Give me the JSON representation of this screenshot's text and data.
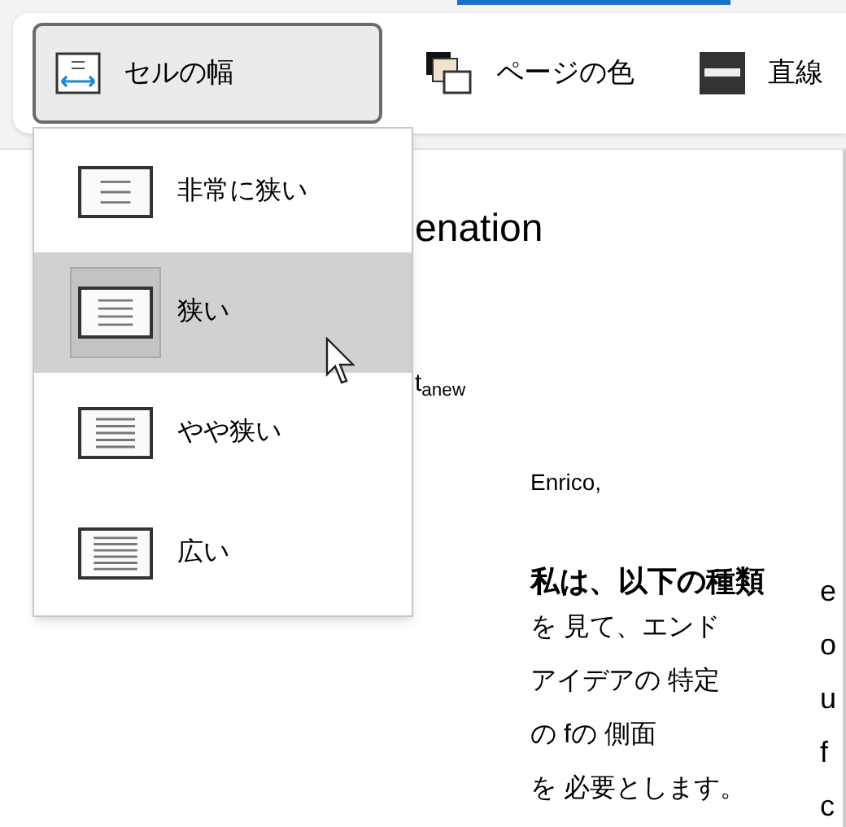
{
  "toolbar": {
    "buttons": [
      {
        "kind": "cell-width",
        "label": "セルの幅",
        "selected": true
      },
      {
        "kind": "page-color",
        "label": "ページの色",
        "selected": false
      },
      {
        "kind": "line",
        "label": "直線",
        "selected": false
      }
    ]
  },
  "dropdown": {
    "items": [
      {
        "label": "非常に狭い",
        "selected": false
      },
      {
        "label": "狭い",
        "selected": true
      },
      {
        "label": "やや狭い",
        "selected": false
      },
      {
        "label": "広い",
        "selected": false
      }
    ]
  },
  "document": {
    "heading": "enation",
    "fragment": "t$_{anew}$",
    "greeting": "Enrico,",
    "paragraph_lead": "私は、以下の種類",
    "paragraph_lines": [
      "を 見て、エンド",
      "アイデアの 特定",
      "の fの 側面",
      "を 必要とします。"
    ],
    "column_2_letters": [
      "e",
      "o",
      "u",
      "f",
      "c"
    ]
  }
}
